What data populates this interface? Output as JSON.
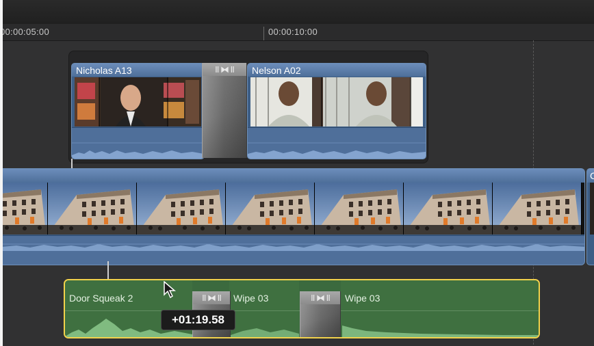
{
  "ruler": {
    "labels": [
      "00:00:05:00",
      "00:00:10:00"
    ]
  },
  "connected_video": {
    "clips": [
      {
        "name": "Nicholas A13"
      },
      {
        "name": "Nelson A02"
      }
    ],
    "transition": {
      "icon": "cross-dissolve-icon",
      "glyph": "II ⧓ II"
    }
  },
  "primary_storyline": {
    "clip": {
      "frames": 7,
      "thumbnail": "building-plaza-thumbnail"
    },
    "next_clip_label": "C"
  },
  "connected_audio": {
    "segments": [
      {
        "name": "Door Squeak 2"
      },
      {
        "name": "Wipe 03"
      },
      {
        "name": "Wipe 03"
      }
    ],
    "transitions": [
      {
        "glyph": "II ⧓ II"
      },
      {
        "glyph": "II ⧓ II"
      }
    ],
    "selected": true,
    "selection_color": "#f2d24b",
    "clip_color": "#3f7040"
  },
  "tooltip": {
    "text": "+01:19.58"
  },
  "colors": {
    "timeline_bg": "#313132",
    "video_clip": "#4e6f99",
    "audio_clip": "#3f7040",
    "selection": "#f2d24b"
  }
}
